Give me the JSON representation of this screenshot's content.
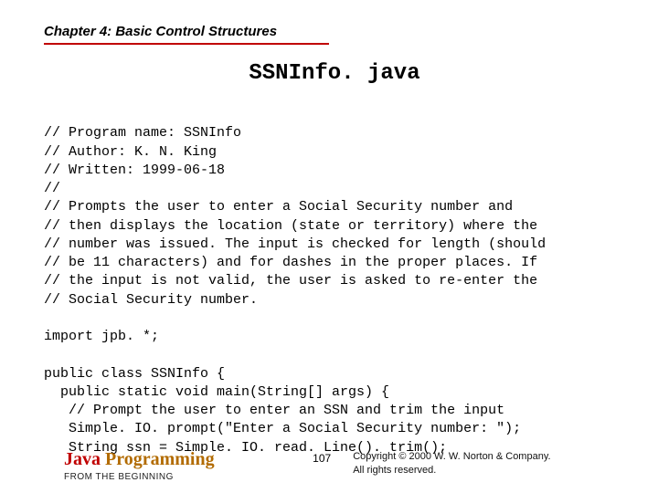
{
  "header": {
    "chapter": "Chapter 4: Basic Control Structures"
  },
  "title": "SSNInfo. java",
  "code": {
    "lines": [
      "// Program name: SSNInfo",
      "// Author: K. N. King",
      "// Written: 1999-06-18",
      "//",
      "// Prompts the user to enter a Social Security number and",
      "// then displays the location (state or territory) where the",
      "// number was issued. The input is checked for length (should",
      "// be 11 characters) and for dashes in the proper places. If",
      "// the input is not valid, the user is asked to re-enter the",
      "// Social Security number.",
      "",
      "import jpb. *;",
      "",
      "public class SSNInfo {",
      "  public static void main(String[] args) {",
      "   // Prompt the user to enter an SSN and trim the input",
      "   Simple. IO. prompt(\"Enter a Social Security number: \");",
      "   String ssn = Simple. IO. read. Line(). trim();"
    ]
  },
  "footer": {
    "brand_java": "Java ",
    "brand_prog": "Programming",
    "brand_sub": "FROM THE BEGINNING",
    "page_number": "107",
    "copyright_line1": "Copyright © 2000 W. W. Norton & Company.",
    "copyright_line2": "All rights reserved."
  }
}
